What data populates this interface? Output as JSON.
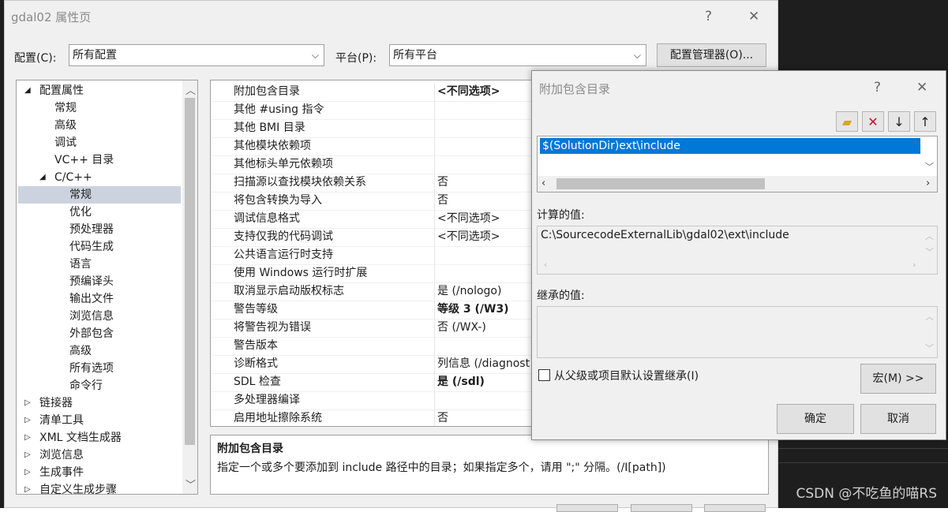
{
  "window": {
    "title": "gdal02 属性页",
    "help": "?",
    "close": "✕"
  },
  "toolbar": {
    "config_label": "配置(C):",
    "config_value": "所有配置",
    "platform_label": "平台(P):",
    "platform_value": "所有平台",
    "config_manager_button": "配置管理器(O)..."
  },
  "tree": {
    "items": [
      {
        "label": "配置属性",
        "expander": "◢"
      },
      {
        "label": "常规"
      },
      {
        "label": "高级"
      },
      {
        "label": "调试"
      },
      {
        "label": "VC++ 目录"
      },
      {
        "label": "C/C++",
        "expander": "◢"
      },
      {
        "label": "常规",
        "selected": true
      },
      {
        "label": "优化"
      },
      {
        "label": "预处理器"
      },
      {
        "label": "代码生成"
      },
      {
        "label": "语言"
      },
      {
        "label": "预编译头"
      },
      {
        "label": "输出文件"
      },
      {
        "label": "浏览信息"
      },
      {
        "label": "外部包含"
      },
      {
        "label": "高级"
      },
      {
        "label": "所有选项"
      },
      {
        "label": "命令行"
      },
      {
        "label": "链接器",
        "expander": "▷"
      },
      {
        "label": "清单工具",
        "expander": "▷"
      },
      {
        "label": "XML 文档生成器",
        "expander": "▷"
      },
      {
        "label": "浏览信息",
        "expander": "▷"
      },
      {
        "label": "生成事件",
        "expander": "▷"
      },
      {
        "label": "自定义生成步骤",
        "expander": "▷"
      }
    ]
  },
  "grid": {
    "rows": [
      {
        "name": "附加包含目录",
        "value": "<不同选项>",
        "bold": true
      },
      {
        "name": "其他 #using 指令",
        "value": ""
      },
      {
        "name": "其他 BMI 目录",
        "value": ""
      },
      {
        "name": "其他模块依赖项",
        "value": ""
      },
      {
        "name": "其他标头单元依赖项",
        "value": ""
      },
      {
        "name": "扫描源以查找模块依赖关系",
        "value": "否"
      },
      {
        "name": "将包含转换为导入",
        "value": "否"
      },
      {
        "name": "调试信息格式",
        "value": "<不同选项>"
      },
      {
        "name": "支持仅我的代码调试",
        "value": "<不同选项>"
      },
      {
        "name": "公共语言运行时支持",
        "value": ""
      },
      {
        "name": "使用 Windows 运行时扩展",
        "value": ""
      },
      {
        "name": "取消显示启动版权标志",
        "value": "是 (/nologo)"
      },
      {
        "name": "警告等级",
        "value": "等级 3 (/W3)",
        "bold": true
      },
      {
        "name": "将警告视为错误",
        "value": "否 (/WX-)"
      },
      {
        "name": "警告版本",
        "value": ""
      },
      {
        "name": "诊断格式",
        "value": "列信息 (/diagnost"
      },
      {
        "name": "SDL 检查",
        "value": "是 (/sdl)",
        "bold": true
      },
      {
        "name": "多处理器编译",
        "value": ""
      },
      {
        "name": "启用地址擦除系统",
        "value": "否"
      }
    ]
  },
  "description": {
    "title": "附加包含目录",
    "text": "指定一个或多个要添加到 include 路径中的目录；如果指定多个，请用 \";\" 分隔。(/I[path])"
  },
  "dialog": {
    "title": "附加包含目录",
    "help": "?",
    "close": "✕",
    "entries": [
      "$(SolutionDir)ext\\include"
    ],
    "computed_label": "计算的值:",
    "computed_value": "C:\\SourcecodeExternalLib\\gdal02\\ext\\include",
    "inherited_label": "继承的值:",
    "inherit_checkbox_label": "从父级或项目默认设置继承(I)",
    "inherit_checked": false,
    "macros_button": "宏(M) >>",
    "ok_button": "确定",
    "cancel_button": "取消"
  },
  "watermark": "CSDN @不吃鱼的喵RS",
  "colors": {
    "selection": "#0078d7",
    "tree_selection": "#cdd3de",
    "dialog_bg": "#f0f0f0",
    "ide_bg": "#1e1e1e"
  }
}
